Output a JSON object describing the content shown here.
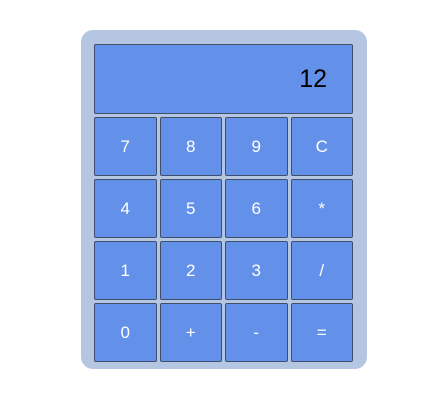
{
  "display": {
    "value": "12"
  },
  "keys": [
    {
      "label": "7",
      "name": "key-7"
    },
    {
      "label": "8",
      "name": "key-8"
    },
    {
      "label": "9",
      "name": "key-9"
    },
    {
      "label": "C",
      "name": "clear-button"
    },
    {
      "label": "4",
      "name": "key-4"
    },
    {
      "label": "5",
      "name": "key-5"
    },
    {
      "label": "6",
      "name": "key-6"
    },
    {
      "label": "*",
      "name": "multiply-button"
    },
    {
      "label": "1",
      "name": "key-1"
    },
    {
      "label": "2",
      "name": "key-2"
    },
    {
      "label": "3",
      "name": "key-3"
    },
    {
      "label": "/",
      "name": "divide-button"
    },
    {
      "label": "0",
      "name": "key-0"
    },
    {
      "label": "+",
      "name": "add-button"
    },
    {
      "label": "-",
      "name": "subtract-button"
    },
    {
      "label": "=",
      "name": "equals-button"
    }
  ],
  "colors": {
    "body": "#b4c6e2",
    "key": "#6390e8",
    "key_border": "#3f4f6a",
    "key_text": "#ffffff",
    "display_text": "#000000"
  }
}
